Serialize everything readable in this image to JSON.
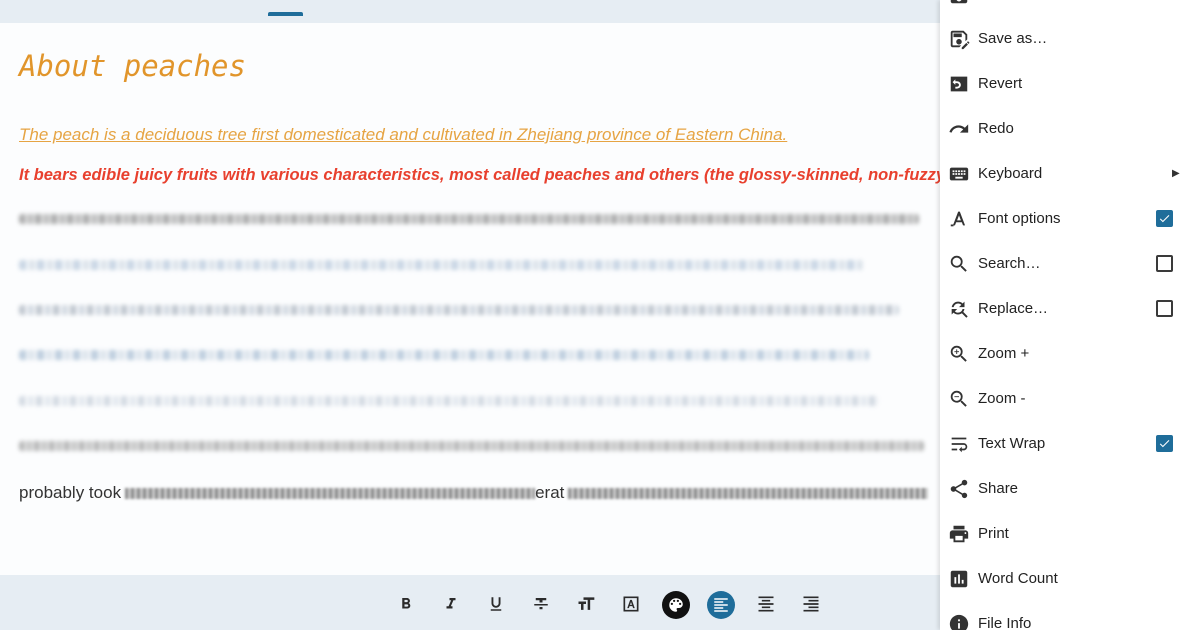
{
  "document": {
    "title": "About peaches",
    "line1": "The peach is a deciduous tree first domesticated and cultivated in Zhejiang province of Eastern China.",
    "line2": "It bears edible juicy fruits with various characteristics, most called peaches and others (the glossy-skinned, non-fuzzy varieties",
    "last_line_start": "probably took",
    "last_line_mid": "erat"
  },
  "menu": {
    "items": [
      {
        "label": "Save as…",
        "icon": "save-as-icon"
      },
      {
        "label": "Revert",
        "icon": "revert-icon"
      },
      {
        "label": "Redo",
        "icon": "redo-icon"
      },
      {
        "label": "Keyboard",
        "icon": "keyboard-icon",
        "submenu": true
      },
      {
        "label": "Font options",
        "icon": "font-options-icon",
        "checked": true
      },
      {
        "label": "Search…",
        "icon": "search-icon",
        "checked": false
      },
      {
        "label": "Replace…",
        "icon": "replace-icon",
        "checked": false
      },
      {
        "label": "Zoom +",
        "icon": "zoom-in-icon"
      },
      {
        "label": "Zoom -",
        "icon": "zoom-out-icon"
      },
      {
        "label": "Text Wrap",
        "icon": "text-wrap-icon",
        "checked": true
      },
      {
        "label": "Share",
        "icon": "share-icon"
      },
      {
        "label": "Print",
        "icon": "print-icon"
      },
      {
        "label": "Word Count",
        "icon": "word-count-icon"
      },
      {
        "label": "File Info",
        "icon": "info-icon"
      }
    ]
  },
  "toolbar": {
    "buttons": [
      {
        "name": "bold-button",
        "icon": "bold-icon"
      },
      {
        "name": "italic-button",
        "icon": "italic-icon"
      },
      {
        "name": "underline-button",
        "icon": "underline-icon"
      },
      {
        "name": "strikethrough-button",
        "icon": "strikethrough-icon"
      },
      {
        "name": "text-size-button",
        "icon": "text-size-icon"
      },
      {
        "name": "text-color-button",
        "icon": "text-color-icon"
      },
      {
        "name": "highlight-color-button",
        "icon": "palette-icon"
      },
      {
        "name": "align-left-button",
        "icon": "align-left-icon",
        "active": true
      },
      {
        "name": "align-center-button",
        "icon": "align-center-icon"
      },
      {
        "name": "align-right-button",
        "icon": "align-right-icon"
      }
    ]
  },
  "colors": {
    "accent": "#1f6d9a",
    "title": "#e1952b",
    "line1": "#e6a443",
    "line2": "#e8402e"
  }
}
